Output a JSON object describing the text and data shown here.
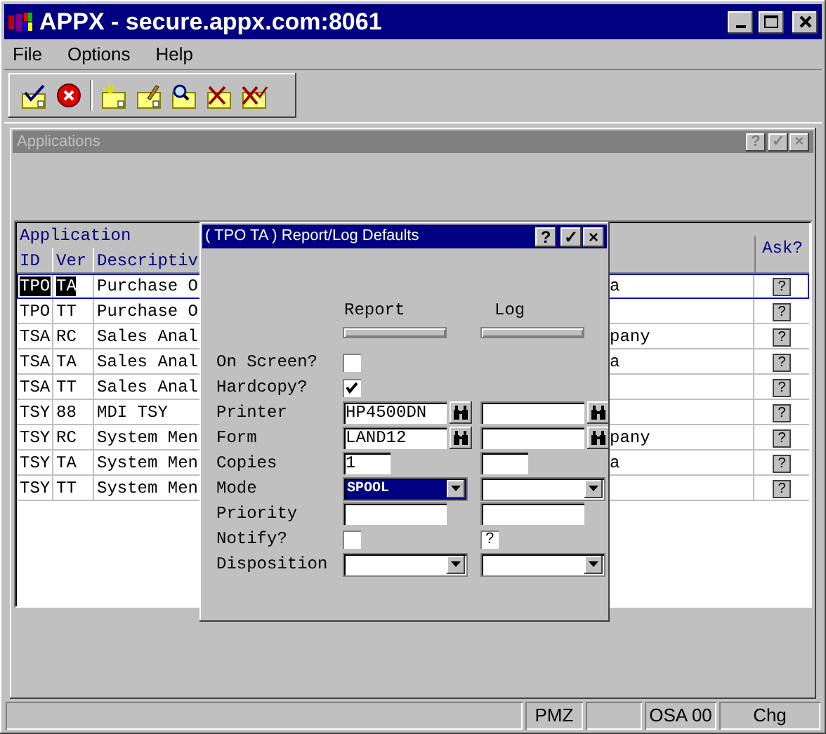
{
  "window": {
    "title": "APPX - secure.appx.com:8061"
  },
  "menu": [
    "File",
    "Options",
    "Help"
  ],
  "toolbar": [
    {
      "kind": "ok"
    },
    {
      "kind": "cancel"
    },
    {
      "kind": "sep"
    },
    {
      "kind": "add"
    },
    {
      "kind": "edit"
    },
    {
      "kind": "inquire"
    },
    {
      "kind": "delete"
    },
    {
      "kind": "delete_all"
    }
  ],
  "inner_window": {
    "title": "Applications",
    "buttons": [
      "?",
      "✓",
      "×"
    ]
  },
  "table": {
    "group_header": "Application",
    "columns": [
      "ID",
      "Ver",
      "Descriptiv",
      "Ask?"
    ],
    "rows": [
      {
        "id": "TPO",
        "ver": "TA",
        "description": "Purchase O",
        "column_4": "a",
        "ask": "?",
        "selected": true
      },
      {
        "id": "TPO",
        "ver": "TT",
        "description": "Purchase O",
        "column_4": "",
        "ask": "?",
        "selected": false
      },
      {
        "id": "TSA",
        "ver": "RC",
        "description": "Sales Anal",
        "column_4": "pany",
        "ask": "?",
        "selected": false
      },
      {
        "id": "TSA",
        "ver": "TA",
        "description": "Sales Anal",
        "column_4": "a",
        "ask": "?",
        "selected": false
      },
      {
        "id": "TSA",
        "ver": "TT",
        "description": "Sales Anal",
        "column_4": "",
        "ask": "?",
        "selected": false
      },
      {
        "id": "TSY",
        "ver": "88",
        "description": "MDI TSY",
        "column_4": "",
        "ask": "?",
        "selected": false
      },
      {
        "id": "TSY",
        "ver": "RC",
        "description": "System Men",
        "column_4": "pany",
        "ask": "?",
        "selected": false
      },
      {
        "id": "TSY",
        "ver": "TA",
        "description": "System Men",
        "column_4": "a",
        "ask": "?",
        "selected": false
      },
      {
        "id": "TSY",
        "ver": "TT",
        "description": "System Men",
        "column_4": "",
        "ask": "?",
        "selected": false
      }
    ]
  },
  "dialog": {
    "title": "( TPO TA ) Report/Log Defaults",
    "buttons": [
      "?",
      "✓",
      "×"
    ],
    "columns": [
      "Report",
      "Log"
    ],
    "fields": [
      {
        "label": "On Screen?",
        "report": {
          "kind": "checkbox",
          "checked": false
        },
        "log": {
          "kind": "none"
        }
      },
      {
        "label": "Hardcopy?",
        "report": {
          "kind": "checkbox",
          "checked": true
        },
        "log": {
          "kind": "none"
        }
      },
      {
        "label": "Printer",
        "report": {
          "kind": "lookup",
          "value": "HP4500DN"
        },
        "log": {
          "kind": "lookup"
        }
      },
      {
        "label": "Form",
        "report": {
          "kind": "lookup",
          "value": "LAND12"
        },
        "log": {
          "kind": "lookup"
        }
      },
      {
        "label": "Copies",
        "report": {
          "kind": "short",
          "value": "1"
        },
        "log": {
          "kind": "short"
        }
      },
      {
        "label": "Mode",
        "report": {
          "kind": "select",
          "value": "SPOOL",
          "focused": true
        },
        "log": {
          "kind": "select",
          "focused": false
        }
      },
      {
        "label": "Priority",
        "report": {
          "kind": "text"
        },
        "log": {
          "kind": "text"
        }
      },
      {
        "label": "Notify?",
        "report": {
          "kind": "checkbox",
          "checked": false
        },
        "log": {
          "kind": "query",
          "value": "?"
        }
      },
      {
        "label": "Disposition",
        "report": {
          "kind": "select",
          "focused": false
        },
        "log": {
          "kind": "select",
          "focused": false
        }
      }
    ]
  },
  "status_bar": [
    {
      "kind": "empty"
    },
    {
      "kind": "text",
      "text": "PMZ"
    },
    {
      "kind": "empty"
    },
    {
      "kind": "text",
      "text": "OSA 00"
    },
    {
      "kind": "text",
      "text": "Chg"
    }
  ]
}
